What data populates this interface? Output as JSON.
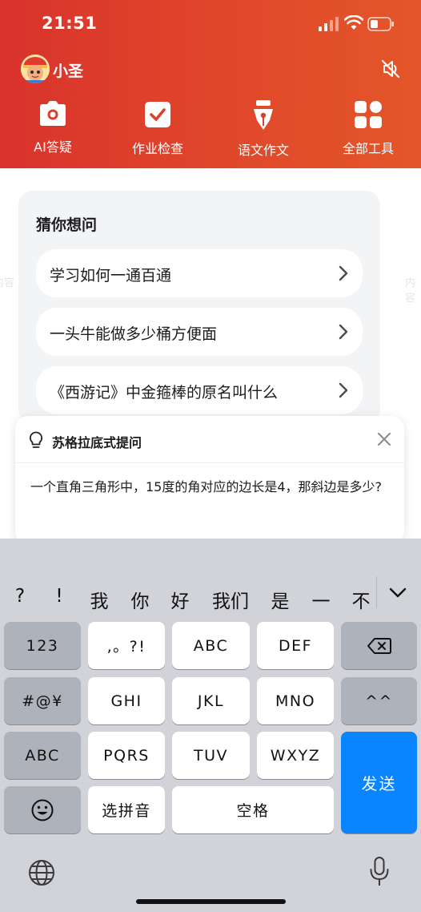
{
  "status_bar": {
    "time": "21:51"
  },
  "user": {
    "name": "小圣"
  },
  "tools": [
    {
      "label": "AI答疑",
      "icon": "camera-icon"
    },
    {
      "label": "作业检查",
      "icon": "checkbox-icon"
    },
    {
      "label": "语文作文",
      "icon": "pen-nib-icon"
    },
    {
      "label": "全部工具",
      "icon": "grid-apps-icon"
    }
  ],
  "suggestions": {
    "title": "猜你想问",
    "items": [
      "学习如何一通百通",
      "一头牛能做多少桶方便面",
      "《西游记》中金箍棒的原名叫什么"
    ]
  },
  "popup": {
    "title": "苏格拉底式提问",
    "text": "一个直角三角形中，15度的角对应的边长是4，那斜边是多少?"
  },
  "keyboard": {
    "candidates": [
      "?",
      "!",
      "我",
      "你",
      "好",
      "我们",
      "是",
      "一",
      "不"
    ],
    "keys": {
      "num": "123",
      "punct": ",。?!",
      "abc1": "ABC",
      "def": "DEF",
      "symbols": "#@¥",
      "ghi": "GHI",
      "jkl": "JKL",
      "mno": "MNO",
      "face": "^^",
      "abc2": "ABC",
      "pqrs": "PQRS",
      "tuv": "TUV",
      "wxyz": "WXYZ",
      "pinyin": "选拼音",
      "space": "空格",
      "send": "发送"
    }
  },
  "colors": {
    "header_start": "#d9332c",
    "header_end": "#e4562a",
    "send": "#0a84ff"
  }
}
